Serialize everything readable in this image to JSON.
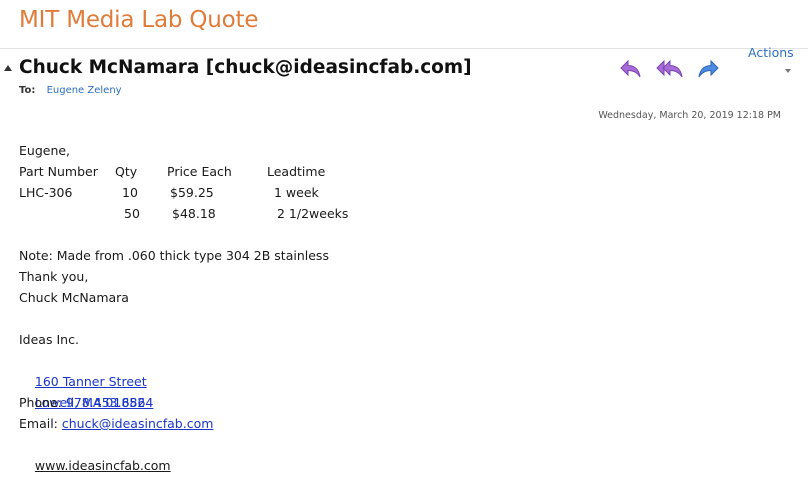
{
  "email": {
    "subject": "MIT Media Lab Quote",
    "sender": "Chuck McNamara [chuck@ideasincfab.com]",
    "to_label": "To:",
    "to_name": "Eugene Zeleny",
    "actions_label": "Actions",
    "date": "Wednesday, March 20, 2019 12:18 PM",
    "greeting": "Eugene,",
    "table": {
      "headers": [
        "Part Number",
        "Qty",
        "Price Each",
        "Leadtime"
      ],
      "rows": [
        [
          "LHC-306",
          "10",
          "$59.25",
          "1 week"
        ],
        [
          "",
          "50",
          "$48.18",
          "2 1/2weeks"
        ]
      ]
    },
    "note": "Note: Made from .060 thick type 304 2B stainless",
    "thanks": "Thank you,",
    "signature_name": "Chuck McNamara",
    "company": "Ideas Inc.",
    "address_line1": "160 Tanner Street",
    "address_line2": "Lowell, MA 01852",
    "phone_label": "Phone: ",
    "phone": "978.453.6864",
    "email_label": "Email: ",
    "email_addr": "chuck@ideasincfab.com",
    "website": "www.ideasincfab.com"
  },
  "icons": {
    "reply": "reply-arrow-icon",
    "reply_all": "reply-all-arrow-icon",
    "forward": "forward-arrow-icon"
  },
  "colors": {
    "subject": "#e07b39",
    "reply": "#9b59c9",
    "forward": "#3b7dd8",
    "link": "#1a36c8",
    "to_name": "#2e6fc2"
  }
}
